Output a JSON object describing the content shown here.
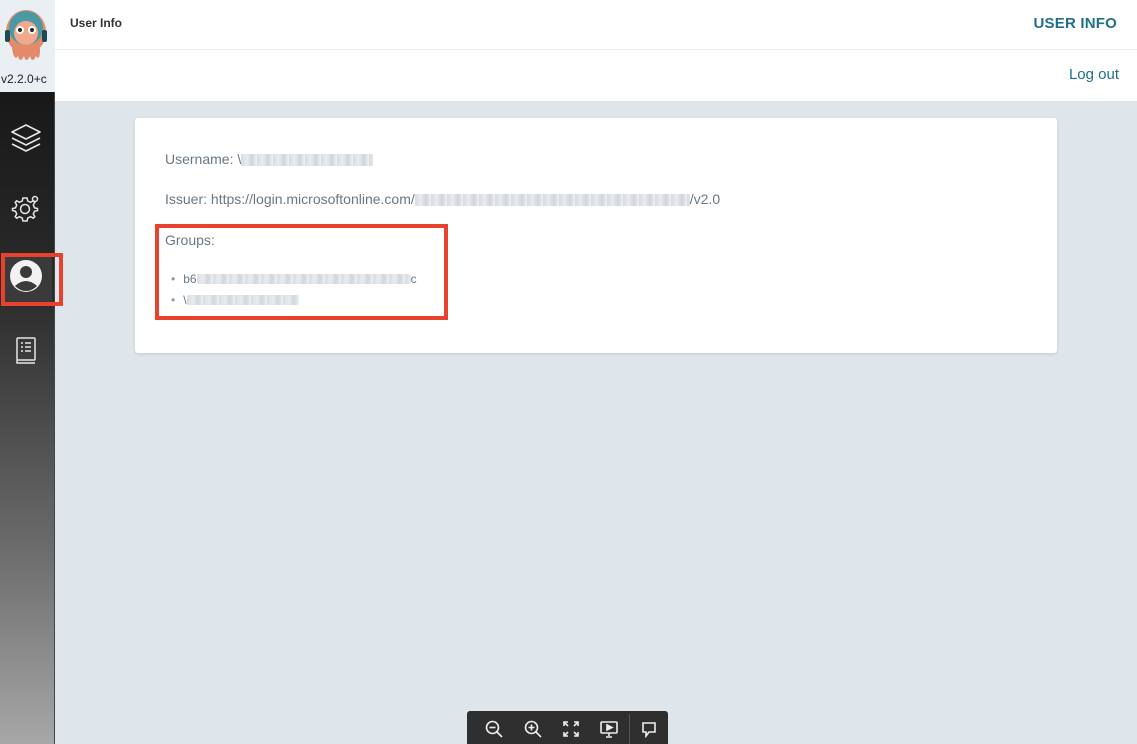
{
  "sidebar": {
    "version": "v2.2.0+c",
    "items": [
      {
        "name": "applications",
        "icon": "layers-icon"
      },
      {
        "name": "settings",
        "icon": "gear-icon"
      },
      {
        "name": "user-info",
        "icon": "user-circle-icon",
        "active": true
      },
      {
        "name": "documentation",
        "icon": "book-icon"
      }
    ],
    "logo_icon": "argo-octopus-logo"
  },
  "header": {
    "title": "User Info",
    "heading": "USER INFO",
    "logout_label": "Log out"
  },
  "user_info": {
    "username_label": "Username:",
    "username_value_prefix": "\\",
    "issuer_label": "Issuer:",
    "issuer_url_prefix": "https://login.microsoftonline.com/",
    "issuer_url_suffix": "/v2.0",
    "groups_label": "Groups:",
    "groups": [
      {
        "prefix": "b6",
        "suffix": "c"
      },
      {
        "prefix": "\\",
        "suffix": ""
      }
    ]
  },
  "toolbar": {
    "buttons": [
      "zoom-out-icon",
      "zoom-in-icon",
      "fit-screen-icon",
      "present-icon",
      "comment-icon"
    ]
  },
  "colors": {
    "accent": "#1f6f8b",
    "highlight": "#e8422e",
    "background": "#dee6eb"
  }
}
